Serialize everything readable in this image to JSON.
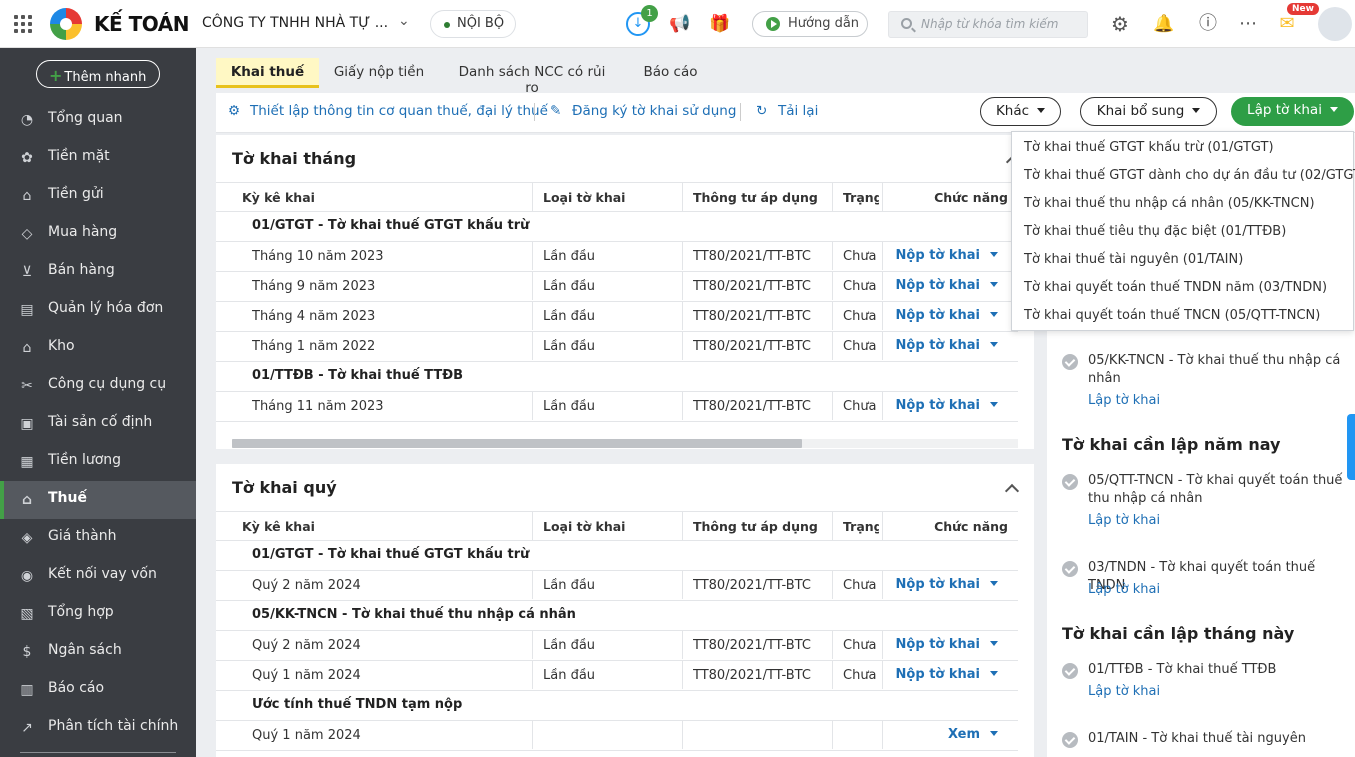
{
  "topbar": {
    "brand": "KẾ TOÁN",
    "company": "CÔNG TY TNHH NHÀ TỰ ...",
    "scope": "NỘI BỘ",
    "download_badge": "1",
    "guide": "Hướng dẫn",
    "search_placeholder": "Nhập từ khóa tìm kiếm",
    "new_badge": "New"
  },
  "sidebar": {
    "quick_add": "Thêm nhanh",
    "items": [
      {
        "label": "Tổng quan",
        "icon": "dashboard-icon"
      },
      {
        "label": "Tiền mặt",
        "icon": "cash-icon"
      },
      {
        "label": "Tiền gửi",
        "icon": "bank-icon"
      },
      {
        "label": "Mua hàng",
        "icon": "shopping-bag-icon"
      },
      {
        "label": "Bán hàng",
        "icon": "cart-icon"
      },
      {
        "label": "Quản lý hóa đơn",
        "icon": "invoice-icon"
      },
      {
        "label": "Kho",
        "icon": "warehouse-icon"
      },
      {
        "label": "Công cụ dụng cụ",
        "icon": "tools-icon"
      },
      {
        "label": "Tài sản cố định",
        "icon": "car-icon"
      },
      {
        "label": "Tiền lương",
        "icon": "payroll-icon"
      },
      {
        "label": "Thuế",
        "icon": "tax-icon"
      },
      {
        "label": "Giá thành",
        "icon": "price-tag-icon"
      },
      {
        "label": "Kết nối vay vốn",
        "icon": "loan-icon"
      },
      {
        "label": "Tổng hợp",
        "icon": "summary-icon"
      },
      {
        "label": "Ngân sách",
        "icon": "budget-icon"
      },
      {
        "label": "Báo cáo",
        "icon": "report-icon"
      },
      {
        "label": "Phân tích tài chính",
        "icon": "analytics-icon"
      }
    ]
  },
  "tabs": [
    "Khai thuế",
    "Giấy nộp tiền",
    "Danh sách NCC có rủi ro",
    "Báo cáo"
  ],
  "toolbar": {
    "setup": "Thiết lập thông tin cơ quan thuế, đại lý thuế",
    "register": "Đăng ký tờ khai sử dụng",
    "reload": "Tải lại",
    "other": "Khác",
    "supplement": "Khai bổ sung",
    "create": "Lập tờ khai"
  },
  "columns": [
    "Kỳ kê khai",
    "Loại tờ khai",
    "Thông tư áp dụng",
    "Trạng t",
    "Chức năng"
  ],
  "monthly": {
    "title": "Tờ khai tháng",
    "groups": [
      {
        "name": "01/GTGT - Tờ khai thuế GTGT khấu trừ",
        "rows": [
          {
            "period": "Tháng 10 năm 2023",
            "type": "Lần đầu",
            "circular": "TT80/2021/TT-BTC",
            "status": "Chưa nộp",
            "action": "Nộp tờ khai"
          },
          {
            "period": "Tháng 9 năm 2023",
            "type": "Lần đầu",
            "circular": "TT80/2021/TT-BTC",
            "status": "Chưa nộp",
            "action": "Nộp tờ khai"
          },
          {
            "period": "Tháng 4 năm 2023",
            "type": "Lần đầu",
            "circular": "TT80/2021/TT-BTC",
            "status": "Chưa nộp",
            "action": "Nộp tờ khai"
          },
          {
            "period": "Tháng 1 năm 2022",
            "type": "Lần đầu",
            "circular": "TT80/2021/TT-BTC",
            "status": "Chưa nộp",
            "action": "Nộp tờ khai"
          }
        ]
      },
      {
        "name": "01/TTĐB - Tờ khai thuế TTĐB",
        "rows": [
          {
            "period": "Tháng 11 năm 2023",
            "type": "Lần đầu",
            "circular": "TT80/2021/TT-BTC",
            "status": "Chưa nộp",
            "action": "Nộp tờ khai"
          }
        ]
      }
    ]
  },
  "quarterly": {
    "title": "Tờ khai quý",
    "groups": [
      {
        "name": "01/GTGT - Tờ khai thuế GTGT khấu trừ",
        "rows": [
          {
            "period": "Quý 2 năm 2024",
            "type": "Lần đầu",
            "circular": "TT80/2021/TT-BTC",
            "status": "Chưa nộp",
            "action": "Nộp tờ khai"
          }
        ]
      },
      {
        "name": "05/KK-TNCN - Tờ khai thuế thu nhập cá nhân",
        "rows": [
          {
            "period": "Quý 2 năm 2024",
            "type": "Lần đầu",
            "circular": "TT80/2021/TT-BTC",
            "status": "Chưa nộp",
            "action": "Nộp tờ khai"
          },
          {
            "period": "Quý 1 năm 2024",
            "type": "Lần đầu",
            "circular": "TT80/2021/TT-BTC",
            "status": "Chưa nộp",
            "action": "Nộp tờ khai"
          }
        ]
      },
      {
        "name": "Ước tính thuế TNDN tạm nộp",
        "rows": [
          {
            "period": "Quý 1 năm 2024",
            "type": "",
            "circular": "",
            "status": "",
            "action": "Xem"
          }
        ]
      }
    ]
  },
  "right_panel": {
    "item_kk": "05/KK-TNCN - Tờ khai thuế thu nhập cá nhân",
    "link": "Lập tờ khai",
    "year_title": "Tờ khai cần lập năm nay",
    "year_items": [
      "05/QTT-TNCN - Tờ khai quyết toán thuế thu nhập cá nhân",
      "03/TNDN - Tờ khai quyết toán thuế TNDN"
    ],
    "month_title": "Tờ khai cần lập tháng này",
    "month_items": [
      "01/TTĐB - Tờ khai thuế TTĐB",
      "01/TAIN - Tờ khai thuế tài nguyên"
    ]
  },
  "dropdown": [
    "Tờ khai thuế GTGT khấu trừ (01/GTGT)",
    "Tờ khai thuế GTGT dành cho dự án đầu tư (02/GTGT)",
    "Tờ khai thuế thu nhập cá nhân (05/KK-TNCN)",
    "Tờ khai thuế tiêu thụ đặc biệt (01/TTĐB)",
    "Tờ khai thuế tài nguyên (01/TAIN)",
    "Tờ khai quyết toán thuế TNDN năm (03/TNDN)",
    "Tờ khai quyết toán thuế TNCN (05/QTT-TNCN)"
  ]
}
